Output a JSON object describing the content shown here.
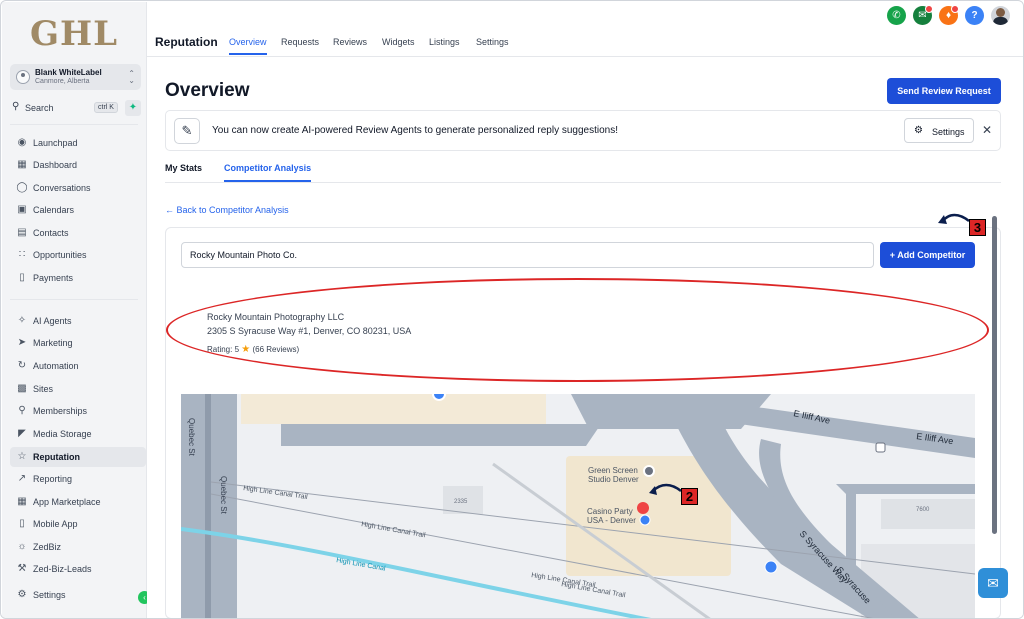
{
  "sidebar": {
    "logo": "GHL",
    "account": {
      "name": "Blank WhiteLabel",
      "location": "Canmore, Alberta"
    },
    "search": {
      "label": "Search",
      "shortcut": "ctrl K"
    },
    "items_top": [
      {
        "label": "Launchpad",
        "icon": "rocket-icon"
      },
      {
        "label": "Dashboard",
        "icon": "dashboard-icon"
      },
      {
        "label": "Conversations",
        "icon": "chat-icon"
      },
      {
        "label": "Calendars",
        "icon": "calendar-icon"
      },
      {
        "label": "Contacts",
        "icon": "contacts-icon"
      },
      {
        "label": "Opportunities",
        "icon": "opportunities-icon"
      },
      {
        "label": "Payments",
        "icon": "payments-icon"
      }
    ],
    "items_bottom": [
      {
        "label": "AI Agents",
        "icon": "sparkles-icon"
      },
      {
        "label": "Marketing",
        "icon": "send-icon"
      },
      {
        "label": "Automation",
        "icon": "automation-icon"
      },
      {
        "label": "Sites",
        "icon": "sites-icon"
      },
      {
        "label": "Memberships",
        "icon": "award-icon"
      },
      {
        "label": "Media Storage",
        "icon": "image-icon"
      },
      {
        "label": "Reputation",
        "icon": "star-icon"
      },
      {
        "label": "Reporting",
        "icon": "trend-icon"
      },
      {
        "label": "App Marketplace",
        "icon": "grid-icon"
      },
      {
        "label": "Mobile App",
        "icon": "phone-icon"
      },
      {
        "label": "ZedBiz",
        "icon": "zedbiz-icon"
      },
      {
        "label": "Zed-Biz-Leads",
        "icon": "wrench-icon"
      }
    ],
    "settings": "Settings"
  },
  "header": {
    "title": "Reputation",
    "tabs": [
      "Overview",
      "Requests",
      "Reviews",
      "Widgets",
      "Listings",
      "Settings"
    ],
    "active_tab": "Overview"
  },
  "main": {
    "page_title": "Overview",
    "send_review_button": "Send Review Request",
    "banner": {
      "text": "You can now create AI-powered Review Agents to generate personalized reply suggestions!",
      "settings_button": "Settings"
    },
    "subtabs": [
      "My Stats",
      "Competitor Analysis"
    ],
    "active_subtab": "Competitor Analysis",
    "back_link": "Back to Competitor Analysis",
    "competitor_input_value": "Rocky Mountain Photo Co.",
    "add_competitor_button": "+ Add Competitor",
    "result": {
      "name": "Rocky Mountain Photography LLC",
      "address": "2305 S Syracuse Way #1, Denver, CO 80231, USA",
      "rating_label": "Rating: 5",
      "reviews": "(66 Reviews)"
    },
    "map": {
      "labels": {
        "quebec_st_1": "Quebec St",
        "quebec_st_2": "Quebec St",
        "iliff_1": "E Iliff Ave",
        "iliff_2": "E Iliff Ave",
        "canal_trail_1": "High Line Canal Trail",
        "canal_trail_2": "High Line Canal Trail",
        "canal_trail_3": "High Line Canal Trail",
        "canal_trail_4": "High Line Canal Trail",
        "canal": "High Line Canal",
        "syracuse_1": "S Syracuse Way",
        "syracuse_2": "S Syracuse",
        "green_screen": "Green Screen Studio Denver",
        "casino_party": "Casino Party USA - Denver",
        "bldg_2335": "2335",
        "bldg_7600": "7600"
      }
    }
  },
  "annotations": {
    "marker_2": "2",
    "marker_3": "3"
  },
  "colors": {
    "accent": "#2563eb",
    "primary_button": "#1d4ed8",
    "annotation_red": "#dc2626",
    "logo": "#a08a66"
  }
}
